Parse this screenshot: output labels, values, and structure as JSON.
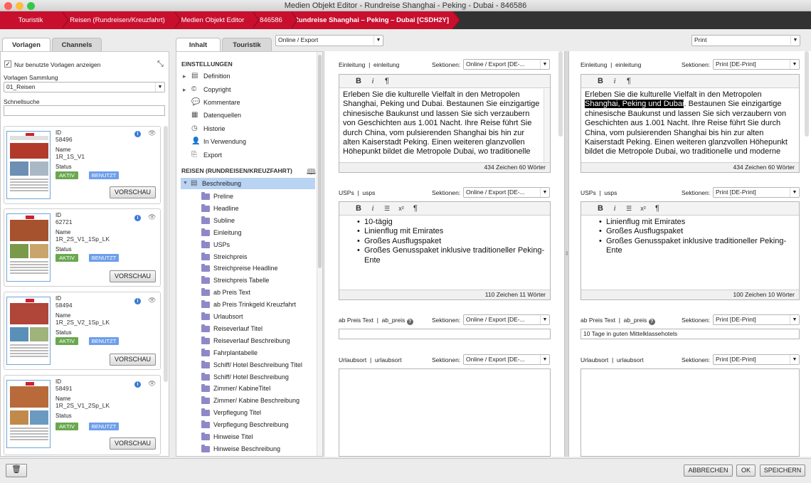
{
  "window": {
    "title": "Medien Objekt Editor - Rundreise Shanghai - Peking - Dubai - 846586"
  },
  "breadcrumb": [
    "Touristik",
    "Reisen (Rundreisen/Kreuzfahrt)",
    "Medien Objekt Editor",
    "846586",
    "Rundreise Shanghai – Peking – Dubai [CSDH2Y]"
  ],
  "left": {
    "tabs": [
      "Vorlagen",
      "Channels"
    ],
    "only_used_label": "Nur benutzte Vorlagen anzeigen",
    "collection_label": "Vorlagen Sammlung",
    "collection_value": "01_Reisen",
    "quicksearch_label": "Schnellsuche",
    "quicksearch_value": "",
    "cards": [
      {
        "id_label": "ID",
        "id": "58496",
        "name_label": "Name",
        "name": "1R_1S_V1",
        "status_label": "Status",
        "status": "AKTIV",
        "used": "BENUTZT",
        "button": "VORSCHAU"
      },
      {
        "id_label": "ID",
        "id": "62721",
        "name_label": "Name",
        "name": "1R_2S_V1_1Sp_LK",
        "status_label": "Status",
        "status": "AKTIV",
        "used": "BENUTZT",
        "button": "VORSCHAU"
      },
      {
        "id_label": "ID",
        "id": "58494",
        "name_label": "Name",
        "name": "1R_2S_V2_1Sp_LK",
        "status_label": "Status",
        "status": "AKTIV",
        "used": "BENUTZT",
        "button": "VORSCHAU"
      },
      {
        "id_label": "ID",
        "id": "58491",
        "name_label": "Name",
        "name": "1R_2S_V1_2Sp_LK",
        "status_label": "Status",
        "status": "AKTIV",
        "used": "BENUTZT",
        "button": "VORSCHAU"
      }
    ]
  },
  "middle": {
    "tabs": [
      "Inhalt",
      "Touristik"
    ],
    "settings_header": "EINSTELLUNGEN",
    "settings": [
      "Definition",
      "Copyright",
      "Kommentare",
      "Datenquellen",
      "Historie",
      "In Verwendung",
      "Export"
    ],
    "section_header": "REISEN (RUNDREISEN/KREUZFAHRT)",
    "selected": "Beschreibung",
    "fields": [
      "Preline",
      "Headline",
      "Subline",
      "Einleitung",
      "USPs",
      "Streichpreis",
      "Streichpreise Headline",
      "Streichpreis Tabelle",
      "ab Preis Text",
      "ab Preis Trinkgeld Kreuzfahrt",
      "Urlaubsort",
      "Reiseverlauf Titel",
      "Reiseverlauf Beschreibung",
      "Fahrplantabelle",
      "Schiff/ Hotel Beschreibung Titel",
      "Schiff/ Hotel Beschreibung",
      "Zimmer/ KabineTitel",
      "Zimmer/ Kabine Beschreibung",
      "Verpflegung Titel",
      "Verpflegung Beschreibung",
      "Hinweise Titel",
      "Hinweise Beschreibung"
    ]
  },
  "channels": [
    {
      "selector": "Online / Export",
      "sections_label": "Sektionen:",
      "einleitung": {
        "label": "Einleitung",
        "key": "einleitung",
        "section": "Online / Export [DE-...",
        "text_pre": "",
        "text_hl": "",
        "text_post": "Erleben Sie die kulturelle Vielfalt in den Metropolen Shanghai, Peking und Dubai. Bestaunen Sie einzigartige chinesische Baukunst und lassen Sie sich verzaubern von Geschichten aus 1.001 Nacht. Ihre Reise führt Sie durch China, vom pulsierenden Shanghai bis hin zur alten Kaiserstadt Peking. Einen weiteren glanzvollen Höhepunkt bildet die Metropole Dubai, wo traditionelle",
        "count": "434 Zeichen   60 Wörter"
      },
      "usps": {
        "label": "USPs",
        "key": "usps",
        "section": "Online / Export [DE-...",
        "items": [
          "10-tägig",
          "Linienflug mit Emirates",
          "Großes Ausflugspaket",
          "Großes Genusspaket inklusive traditioneller Peking-Ente"
        ],
        "count": "110 Zeichen   11 Wörter"
      },
      "abpreis": {
        "label": "ab Preis Text",
        "key": "ab_preis",
        "section": "Online / Export [DE-...",
        "value": ""
      },
      "urlaubsort": {
        "label": "Urlaubsort",
        "key": "urlaubsort",
        "section": "Online / Export [DE-..."
      }
    },
    {
      "selector": "Print",
      "sections_label": "Sektionen:",
      "einleitung": {
        "label": "Einleitung",
        "key": "einleitung",
        "section": "Print [DE-Print]",
        "text_pre": "Erleben Sie die kulturelle Vielfalt in den Metropolen ",
        "text_hl": "Shanghai, Peking und Dubai",
        "text_post": ". Bestaunen Sie einzigartige chinesische Baukunst und lassen Sie sich verzaubern von Geschichten aus 1.001 Nacht. Ihre Reise führt Sie durch China, vom pulsierenden Shanghai bis hin zur alten Kaiserstadt Peking. Einen weiteren glanzvollen Höhepunkt bildet die Metropole Dubai, wo traditionelle und moderne",
        "count": "434 Zeichen   60 Wörter"
      },
      "usps": {
        "label": "USPs",
        "key": "usps",
        "section": "Print [DE-Print]",
        "items": [
          "Linienflug mit Emirates",
          "Großes Ausflugspaket",
          "Großes Genusspaket inklusive traditioneller Peking-Ente"
        ],
        "count": "100 Zeichen   10 Wörter"
      },
      "abpreis": {
        "label": "ab Preis Text",
        "key": "ab_preis",
        "section": "Print [DE-Print]",
        "value": "10 Tage in guten Mittelklassehotels"
      },
      "urlaubsort": {
        "label": "Urlaubsort",
        "key": "urlaubsort",
        "section": "Print [DE-Print]"
      }
    }
  ],
  "footer": {
    "cancel": "ABBRECHEN",
    "ok": "OK",
    "save": "SPEICHERN"
  },
  "colors": {
    "brand_red": "#c8102e",
    "active_green": "#6aa84f",
    "used_blue": "#6d9eeb"
  }
}
